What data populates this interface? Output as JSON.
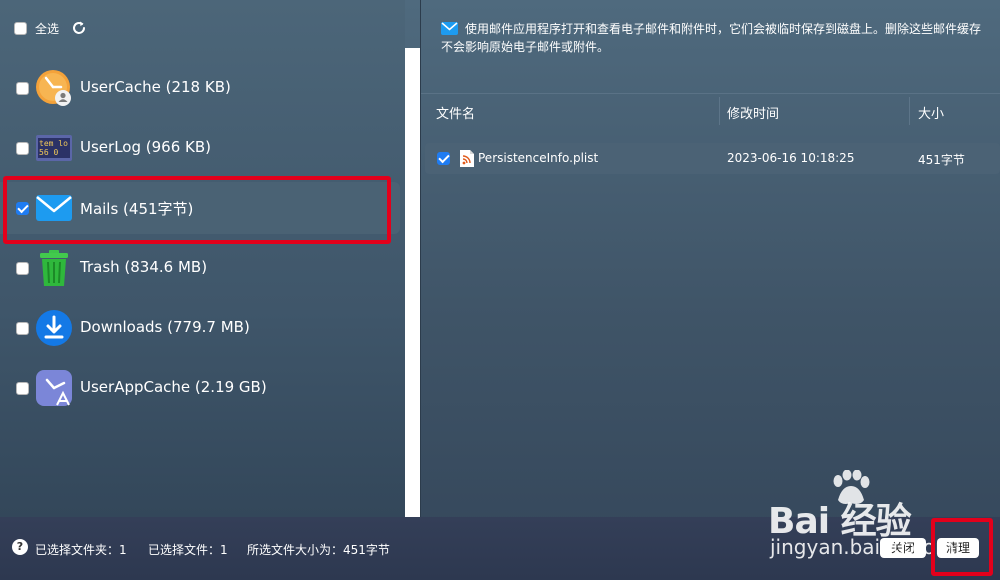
{
  "left_pane": {
    "select_all_label": "全选",
    "folders": [
      {
        "label": "UserCache (218 KB)",
        "checked": false,
        "icon": "user-cache-clock-icon"
      },
      {
        "label": "UserLog (966 KB)",
        "checked": false,
        "icon": "user-log-icon",
        "icon_text_1": "tem lo",
        "icon_text_2": "56 0"
      },
      {
        "label": "Mails (451字节)",
        "checked": true,
        "icon": "mail-envelope-icon"
      },
      {
        "label": "Trash (834.6 MB)",
        "checked": false,
        "icon": "trash-can-icon"
      },
      {
        "label": "Downloads (779.7 MB)",
        "checked": false,
        "icon": "download-arrow-icon"
      },
      {
        "label": "UserAppCache (2.19 GB)",
        "checked": false,
        "icon": "user-app-cache-icon"
      }
    ]
  },
  "right_pane": {
    "description": "使用邮件应用程序打开和查看电子邮件和附件时，它们会被临时保存到磁盘上。删除这些邮件缓存不会影响原始电子邮件或附件。",
    "columns": {
      "name": "文件名",
      "modified": "修改时间",
      "size": "大小"
    },
    "files": [
      {
        "name": "PersistenceInfo.plist",
        "modified": "2023-06-16 10:18:25",
        "size": "451字节",
        "checked": true,
        "icon": "rss-file-icon"
      }
    ]
  },
  "bottom_bar": {
    "selected_folders": "已选择文件夹：1",
    "selected_files": "已选择文件：1",
    "selected_size": "所选文件大小为：451字节",
    "close_button": "关闭",
    "clean_button": "清理"
  },
  "watermark": {
    "brand": "Bai 经验",
    "url": "jingyan.baidu.com"
  },
  "colors": {
    "accent": "#1f7cf2",
    "highlight_box": "#e3001b"
  }
}
